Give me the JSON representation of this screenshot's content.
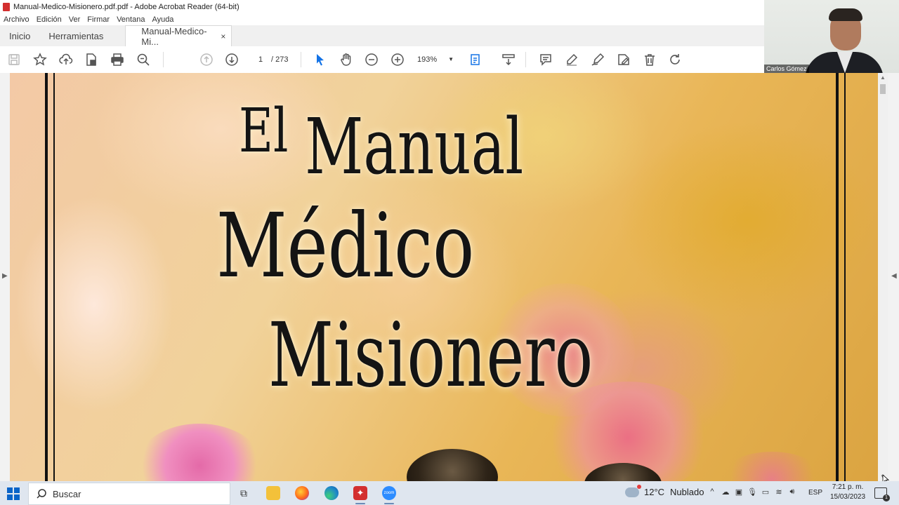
{
  "window": {
    "title": "Manual-Medico-Misionero.pdf.pdf - Adobe Acrobat Reader (64-bit)"
  },
  "menu": [
    "Archivo",
    "Edición",
    "Ver",
    "Firmar",
    "Ventana",
    "Ayuda"
  ],
  "tabs": {
    "home": "Inicio",
    "tools": "Herramientas",
    "document": "Manual-Medico-Mi...",
    "close": "×"
  },
  "toolbar": {
    "current_page": "1",
    "total_pages": "/ 273",
    "zoom": "193%",
    "icons": [
      "save-icon",
      "bookmark-star-icon",
      "upload-cloud-icon",
      "document-lock-icon",
      "print-icon",
      "zoom-search-icon",
      "page-up-icon",
      "page-down-icon",
      "select-cursor-icon",
      "hand-tool-icon",
      "zoom-out-icon",
      "zoom-in-icon",
      "fit-page-icon",
      "scroll-mode-icon",
      "comment-icon",
      "highlight-pen-icon",
      "sign-icon",
      "edit-send-icon",
      "delete-icon",
      "rotate-icon"
    ]
  },
  "webcam": {
    "participant_name": "Carlos Gómez"
  },
  "cover": {
    "line1": "El",
    "line2": "Manual",
    "line3": "Médico",
    "line4": "Misionero"
  },
  "taskbar": {
    "search_placeholder": "Buscar",
    "apps": [
      "task-view-icon",
      "file-explorer-icon",
      "firefox-icon",
      "edge-icon",
      "acrobat-icon",
      "zoom-icon"
    ],
    "zoom_label": "zoom",
    "weather_temp": "12°C",
    "weather_desc": "Nublado",
    "language": "ESP",
    "time": "7:21 p. m.",
    "date": "15/03/2023",
    "notification_count": "1"
  },
  "colors": {
    "taskbar_bg": "#dfe6ef",
    "acrobat_red": "#d32f2f",
    "edge_blue": "#1f88c9",
    "zoom_blue": "#2d8cff"
  }
}
